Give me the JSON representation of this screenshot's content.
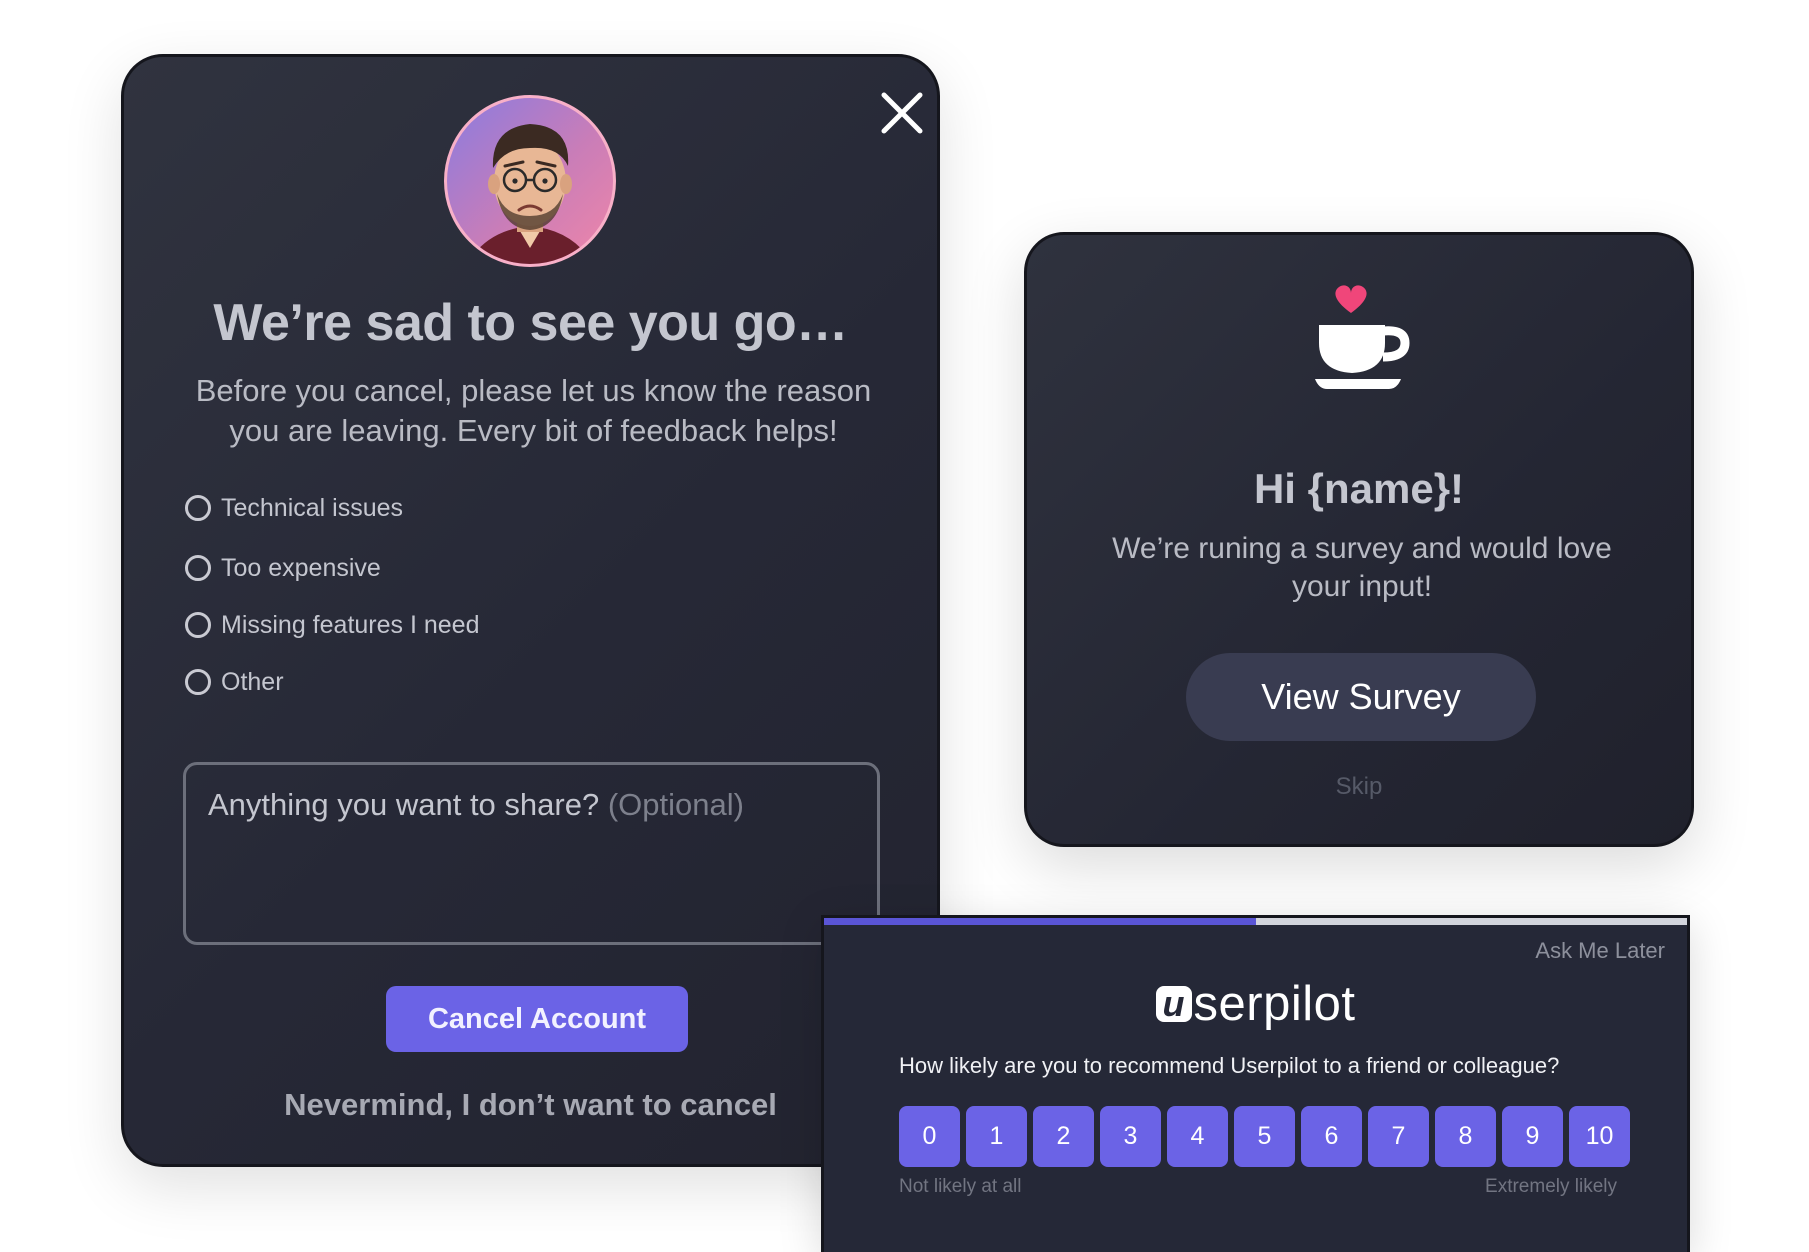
{
  "cancel_modal": {
    "title": "We’re sad to see you go…",
    "subtitle": "Before you cancel, please let us know the reason you are leaving. Every bit of feedback helps!",
    "reasons": [
      "Technical issues",
      "Too expensive",
      "Missing features I need",
      "Other"
    ],
    "feedback_placeholder": "Anything you want to share?",
    "feedback_optional": "(Optional)",
    "cancel_button": "Cancel Account",
    "nevermind_link": "Nevermind, I don’t want to cancel",
    "icons": {
      "close": "close-icon",
      "avatar": "avatar"
    }
  },
  "survey_card": {
    "icon": "coffee-cup-heart-icon",
    "title": "Hi {name}!",
    "subtitle": "We’re runing a survey and would love your input!",
    "view_button": "View Survey",
    "skip_link": "Skip"
  },
  "nps_widget": {
    "progress": 0.5,
    "ask_later": "Ask Me Later",
    "brand_initial": "u",
    "brand_rest": "serpilot",
    "question": "How likely are you to recommend Userpilot to a friend or colleague?",
    "scale": [
      "0",
      "1",
      "2",
      "3",
      "4",
      "5",
      "6",
      "7",
      "8",
      "9",
      "10"
    ],
    "low_label": "Not likely at all",
    "high_label": "Extremely likely"
  },
  "colors": {
    "accent": "#6b63e6",
    "modal_bg": "#262836",
    "heart": "#f0467a",
    "progress": "#5a55d6"
  }
}
